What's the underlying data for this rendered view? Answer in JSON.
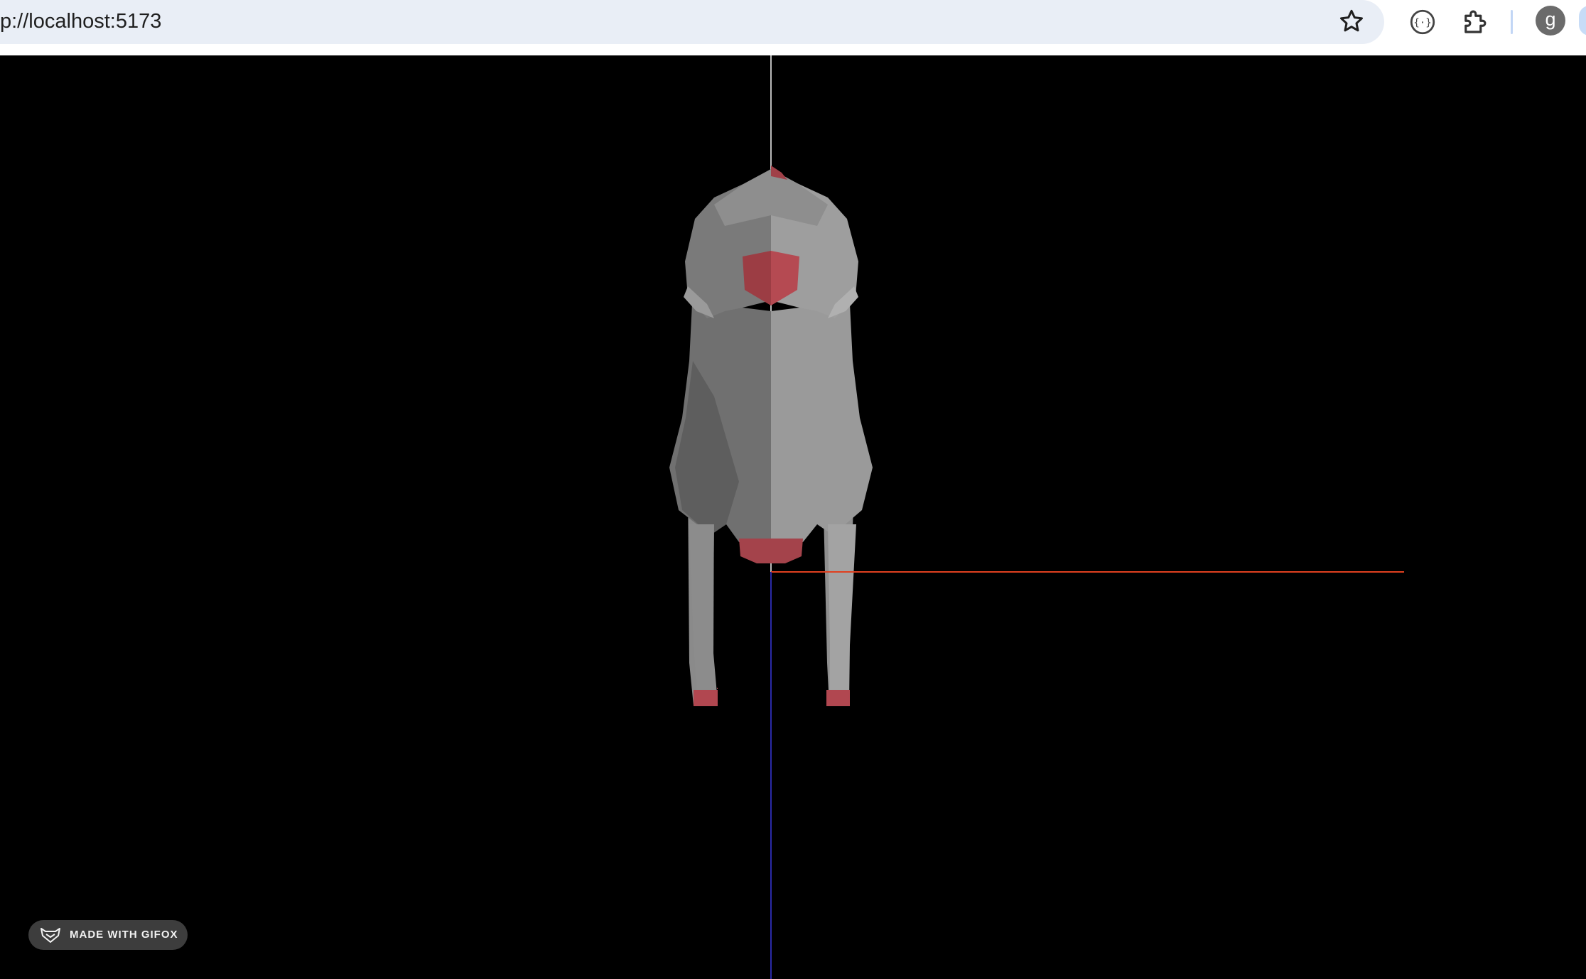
{
  "browser": {
    "url": "p://localhost:5173",
    "profile_initial": "g",
    "icons": [
      "star-icon",
      "extension-inspector-icon",
      "puzzle-extensions-icon"
    ]
  },
  "scene": {
    "background": "#000000",
    "axis_colors": {
      "x_axis": "#e0401f",
      "y_axis": "#bbbbbb",
      "z_axis": "#2a2aa8"
    },
    "model": {
      "body_color": "#8c8c8c",
      "accent_color": "#b04a4f"
    }
  },
  "watermark": {
    "label": "MADE WITH GIFOX",
    "icon": "fox-icon"
  }
}
